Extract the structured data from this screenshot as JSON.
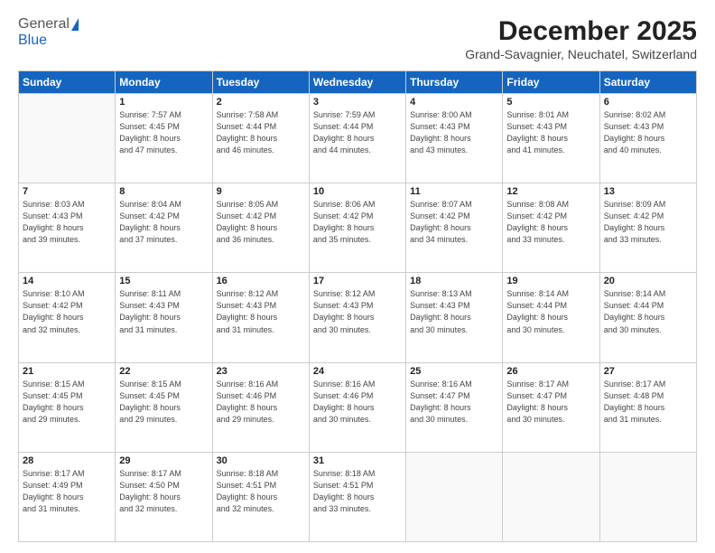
{
  "logo": {
    "general": "General",
    "blue": "Blue"
  },
  "title": "December 2025",
  "subtitle": "Grand-Savagnier, Neuchatel, Switzerland",
  "days_header": [
    "Sunday",
    "Monday",
    "Tuesday",
    "Wednesday",
    "Thursday",
    "Friday",
    "Saturday"
  ],
  "weeks": [
    [
      {
        "num": "",
        "info": ""
      },
      {
        "num": "1",
        "info": "Sunrise: 7:57 AM\nSunset: 4:45 PM\nDaylight: 8 hours\nand 47 minutes."
      },
      {
        "num": "2",
        "info": "Sunrise: 7:58 AM\nSunset: 4:44 PM\nDaylight: 8 hours\nand 46 minutes."
      },
      {
        "num": "3",
        "info": "Sunrise: 7:59 AM\nSunset: 4:44 PM\nDaylight: 8 hours\nand 44 minutes."
      },
      {
        "num": "4",
        "info": "Sunrise: 8:00 AM\nSunset: 4:43 PM\nDaylight: 8 hours\nand 43 minutes."
      },
      {
        "num": "5",
        "info": "Sunrise: 8:01 AM\nSunset: 4:43 PM\nDaylight: 8 hours\nand 41 minutes."
      },
      {
        "num": "6",
        "info": "Sunrise: 8:02 AM\nSunset: 4:43 PM\nDaylight: 8 hours\nand 40 minutes."
      }
    ],
    [
      {
        "num": "7",
        "info": "Sunrise: 8:03 AM\nSunset: 4:43 PM\nDaylight: 8 hours\nand 39 minutes."
      },
      {
        "num": "8",
        "info": "Sunrise: 8:04 AM\nSunset: 4:42 PM\nDaylight: 8 hours\nand 37 minutes."
      },
      {
        "num": "9",
        "info": "Sunrise: 8:05 AM\nSunset: 4:42 PM\nDaylight: 8 hours\nand 36 minutes."
      },
      {
        "num": "10",
        "info": "Sunrise: 8:06 AM\nSunset: 4:42 PM\nDaylight: 8 hours\nand 35 minutes."
      },
      {
        "num": "11",
        "info": "Sunrise: 8:07 AM\nSunset: 4:42 PM\nDaylight: 8 hours\nand 34 minutes."
      },
      {
        "num": "12",
        "info": "Sunrise: 8:08 AM\nSunset: 4:42 PM\nDaylight: 8 hours\nand 33 minutes."
      },
      {
        "num": "13",
        "info": "Sunrise: 8:09 AM\nSunset: 4:42 PM\nDaylight: 8 hours\nand 33 minutes."
      }
    ],
    [
      {
        "num": "14",
        "info": "Sunrise: 8:10 AM\nSunset: 4:42 PM\nDaylight: 8 hours\nand 32 minutes."
      },
      {
        "num": "15",
        "info": "Sunrise: 8:11 AM\nSunset: 4:43 PM\nDaylight: 8 hours\nand 31 minutes."
      },
      {
        "num": "16",
        "info": "Sunrise: 8:12 AM\nSunset: 4:43 PM\nDaylight: 8 hours\nand 31 minutes."
      },
      {
        "num": "17",
        "info": "Sunrise: 8:12 AM\nSunset: 4:43 PM\nDaylight: 8 hours\nand 30 minutes."
      },
      {
        "num": "18",
        "info": "Sunrise: 8:13 AM\nSunset: 4:43 PM\nDaylight: 8 hours\nand 30 minutes."
      },
      {
        "num": "19",
        "info": "Sunrise: 8:14 AM\nSunset: 4:44 PM\nDaylight: 8 hours\nand 30 minutes."
      },
      {
        "num": "20",
        "info": "Sunrise: 8:14 AM\nSunset: 4:44 PM\nDaylight: 8 hours\nand 30 minutes."
      }
    ],
    [
      {
        "num": "21",
        "info": "Sunrise: 8:15 AM\nSunset: 4:45 PM\nDaylight: 8 hours\nand 29 minutes."
      },
      {
        "num": "22",
        "info": "Sunrise: 8:15 AM\nSunset: 4:45 PM\nDaylight: 8 hours\nand 29 minutes."
      },
      {
        "num": "23",
        "info": "Sunrise: 8:16 AM\nSunset: 4:46 PM\nDaylight: 8 hours\nand 29 minutes."
      },
      {
        "num": "24",
        "info": "Sunrise: 8:16 AM\nSunset: 4:46 PM\nDaylight: 8 hours\nand 30 minutes."
      },
      {
        "num": "25",
        "info": "Sunrise: 8:16 AM\nSunset: 4:47 PM\nDaylight: 8 hours\nand 30 minutes."
      },
      {
        "num": "26",
        "info": "Sunrise: 8:17 AM\nSunset: 4:47 PM\nDaylight: 8 hours\nand 30 minutes."
      },
      {
        "num": "27",
        "info": "Sunrise: 8:17 AM\nSunset: 4:48 PM\nDaylight: 8 hours\nand 31 minutes."
      }
    ],
    [
      {
        "num": "28",
        "info": "Sunrise: 8:17 AM\nSunset: 4:49 PM\nDaylight: 8 hours\nand 31 minutes."
      },
      {
        "num": "29",
        "info": "Sunrise: 8:17 AM\nSunset: 4:50 PM\nDaylight: 8 hours\nand 32 minutes."
      },
      {
        "num": "30",
        "info": "Sunrise: 8:18 AM\nSunset: 4:51 PM\nDaylight: 8 hours\nand 32 minutes."
      },
      {
        "num": "31",
        "info": "Sunrise: 8:18 AM\nSunset: 4:51 PM\nDaylight: 8 hours\nand 33 minutes."
      },
      {
        "num": "",
        "info": ""
      },
      {
        "num": "",
        "info": ""
      },
      {
        "num": "",
        "info": ""
      }
    ]
  ]
}
